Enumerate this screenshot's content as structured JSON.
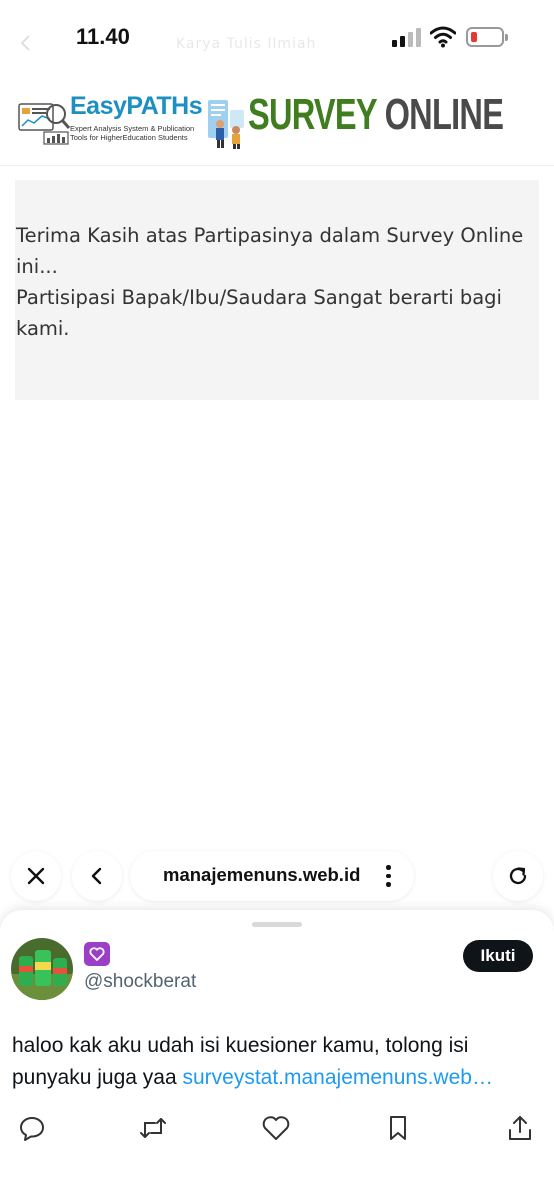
{
  "status_bar": {
    "time": "11.40",
    "ghost_title": "Karya Tulis Ilmiah",
    "battery_level": 0.12
  },
  "banner": {
    "logo_text": "EasyPATHs",
    "tagline_line1": "Expert Analysis System & Publication",
    "tagline_line2": "Tools for HigherEducation Students",
    "title_part1": "SURVEY",
    "title_part2": "ONLINE",
    "colors": {
      "logo_blue": "#1d8fc0",
      "title_green": "#3f7d1f",
      "title_gray": "#4a4a4a"
    }
  },
  "message": {
    "lines": [
      "Terima Kasih atas Partipasinya dalam Survey Online",
      "ini...",
      "Partisipasi Bapak/Ibu/Saudara Sangat berarti bagi",
      "kami."
    ]
  },
  "browser_toolbar": {
    "close_icon": "close-icon",
    "back_icon": "chevron-left-icon",
    "url": "manajemenuns.web.id",
    "menu_icon": "more-vertical-icon",
    "reload_icon": "reload-icon"
  },
  "tweet": {
    "display_name_icon": "purple-heart-icon",
    "handle": "@shockberat",
    "follow_label": "Ikuti",
    "text_line1": "haloo kak aku udah isi kuesioner kamu, tolong isi",
    "text_line2_prefix": "punyaku juga yaa ",
    "link_text": "surveystat.manajemenuns.web…",
    "actions": [
      "reply-icon",
      "retweet-icon",
      "like-icon",
      "bookmark-icon",
      "share-icon"
    ],
    "colors": {
      "link": "#1d9bf0",
      "follow_bg": "#0f1419",
      "handle": "#536471"
    }
  }
}
